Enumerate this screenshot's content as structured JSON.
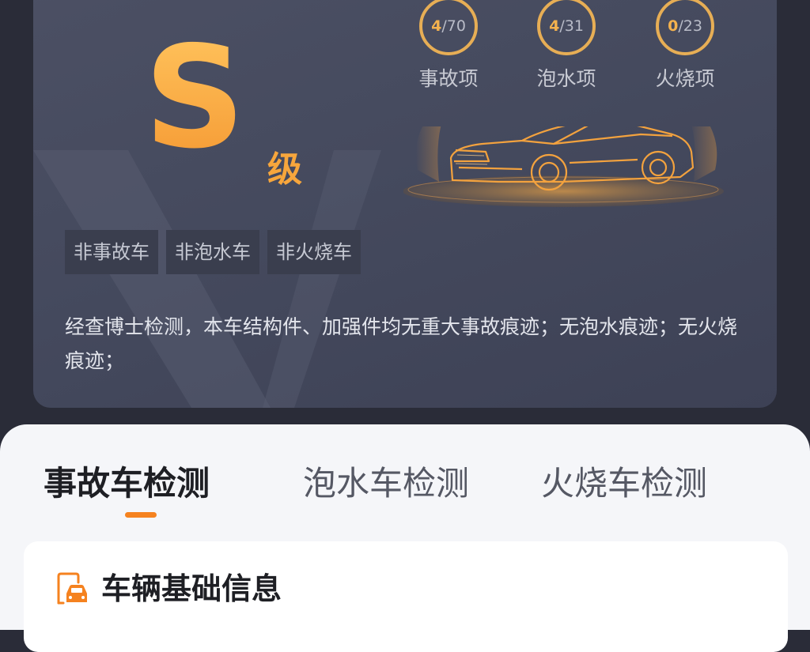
{
  "report": {
    "grade_letter": "S",
    "grade_suffix": "级",
    "stats": [
      {
        "checked": "4",
        "total": "/70",
        "label": "事故项"
      },
      {
        "checked": "4",
        "total": "/31",
        "label": "泡水项"
      },
      {
        "checked": "0",
        "total": "/23",
        "label": "火烧项"
      }
    ],
    "tags": [
      "非事故车",
      "非泡水车",
      "非火烧车"
    ],
    "summary": "经查博士检测，本车结构件、加强件均无重大事故痕迹；无泡水痕迹；无火烧痕迹；"
  },
  "tabs": [
    "事故车检测",
    "泡水车检测",
    "火烧车检测"
  ],
  "active_tab": "事故车检测",
  "section": {
    "title": "车辆基础信息",
    "icon": "car-document-icon"
  },
  "colors": {
    "accent": "#f5821f",
    "grade": "#f7a63c",
    "ring": "#e7ae55",
    "card": "#4a4e62"
  }
}
